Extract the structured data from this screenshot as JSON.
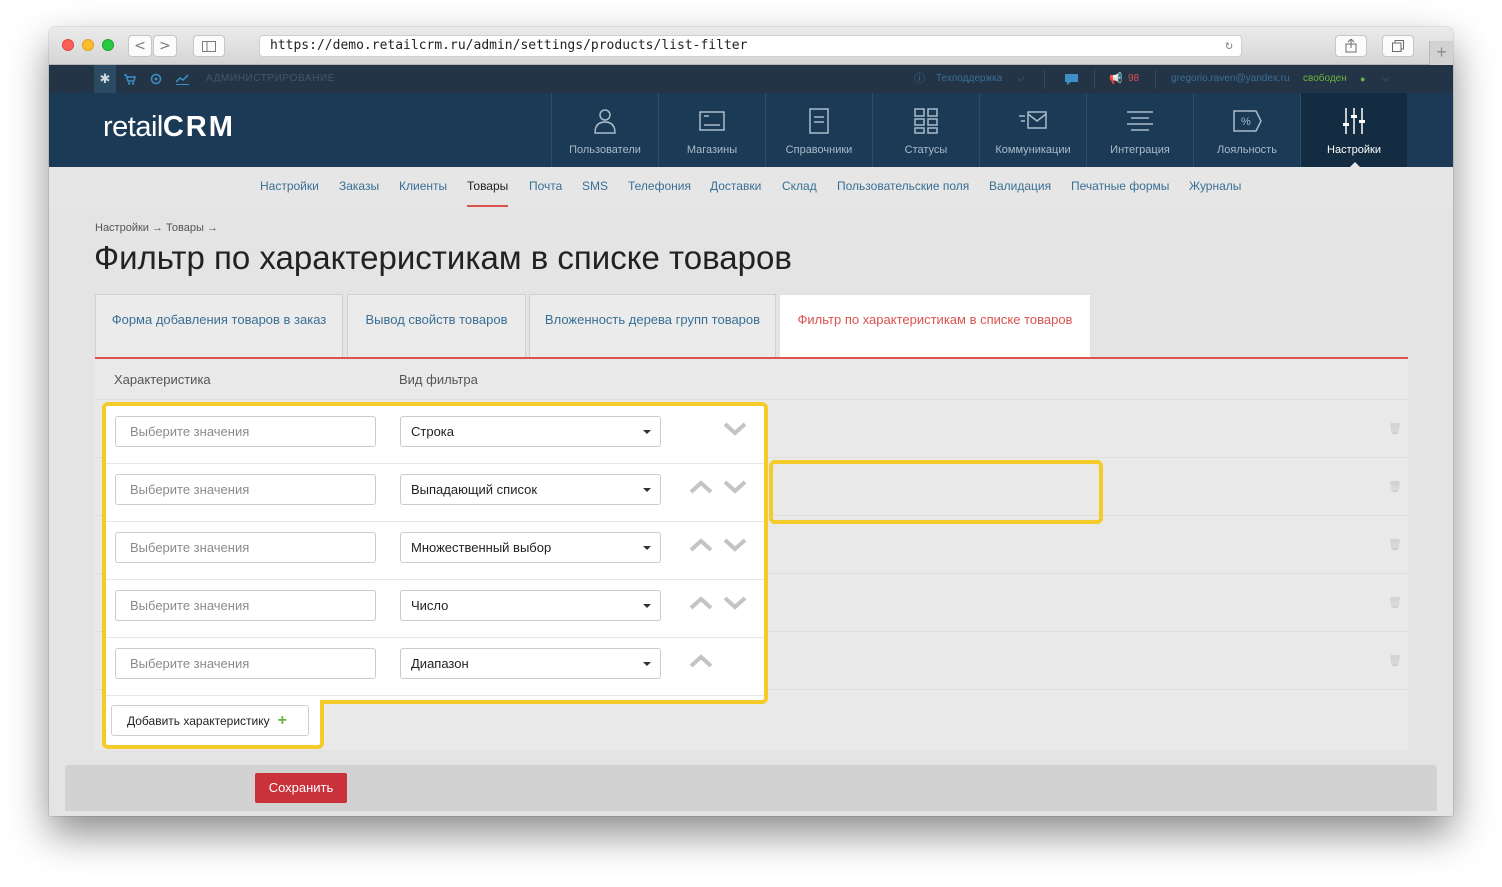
{
  "browser": {
    "url": "https://demo.retailcrm.ru/admin/settings/products/list-filter",
    "back_label": "<",
    "forward_label": ">",
    "newtab_label": "+"
  },
  "adminbar": {
    "label": "АДМИНИСТРИРОВАНИЕ",
    "support": "Техподдержка",
    "notifications_count": "98",
    "user_email": "gregorio.raven@yandex.ru",
    "user_status": "свободен"
  },
  "logo": {
    "retail": "retail",
    "crm": "CRM"
  },
  "mainnav": [
    {
      "label": "Пользователи",
      "icon": "user-icon"
    },
    {
      "label": "Магазины",
      "icon": "store-icon"
    },
    {
      "label": "Справочники",
      "icon": "document-icon"
    },
    {
      "label": "Статусы",
      "icon": "grid-icon"
    },
    {
      "label": "Коммуникации",
      "icon": "mail-icon"
    },
    {
      "label": "Интеграция",
      "icon": "lines-icon"
    },
    {
      "label": "Лояльность",
      "icon": "discount-icon"
    },
    {
      "label": "Настройки",
      "icon": "sliders-icon"
    }
  ],
  "subnav": [
    "Настройки",
    "Заказы",
    "Клиенты",
    "Товары",
    "Почта",
    "SMS",
    "Телефония",
    "Доставки",
    "Склад",
    "Пользовательские поля",
    "Валидация",
    "Печатные формы",
    "Журналы"
  ],
  "breadcrumb": "Настройки → Товары →",
  "page_title": "Фильтр по характеристикам в списке товаров",
  "tabs": [
    "Форма добавления товаров в заказ",
    "Вывод свойств товаров",
    "Вложенность дерева групп товаров",
    "Фильтр по характеристикам в списке товаров"
  ],
  "columns": {
    "characteristic": "Характеристика",
    "filter_type": "Вид фильтра"
  },
  "rows": [
    {
      "placeholder": "Выберите значения",
      "filter": "Строка",
      "up": false,
      "down": true
    },
    {
      "placeholder": "Выберите значения",
      "filter": "Выпадающий список",
      "up": true,
      "down": true
    },
    {
      "placeholder": "Выберите значения",
      "filter": "Множественный выбор",
      "up": true,
      "down": true
    },
    {
      "placeholder": "Выберите значения",
      "filter": "Число",
      "up": true,
      "down": true
    },
    {
      "placeholder": "Выберите значения",
      "filter": "Диапазон",
      "up": true,
      "down": false
    }
  ],
  "add_button": "Добавить характеристику",
  "save_button": "Сохранить",
  "colors": {
    "accent": "#d9534f",
    "highlight": "#f4cb29",
    "nav": "#1b3a55",
    "save": "#c9323a"
  }
}
